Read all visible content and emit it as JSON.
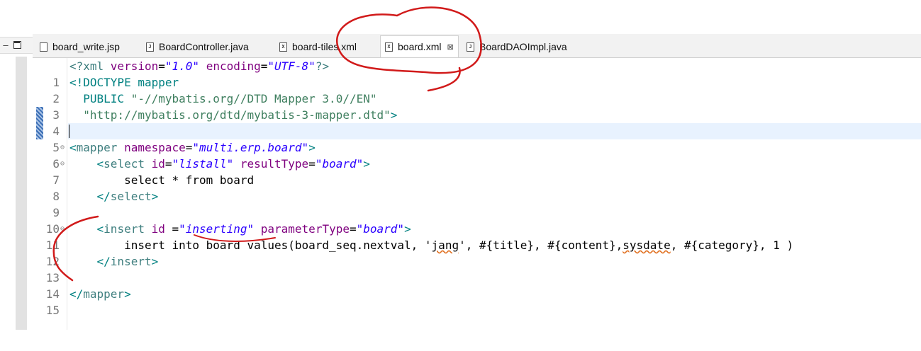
{
  "window": {
    "minimize_glyph": "–"
  },
  "tabs": [
    {
      "label": "board_write.jsp",
      "icon": "jsp-file-icon"
    },
    {
      "label": "BoardController.java",
      "icon": "java-file-icon"
    },
    {
      "label": "board-tiles.xml",
      "icon": "xml-file-icon"
    },
    {
      "label": "board.xml",
      "icon": "xml-file-icon",
      "active": true,
      "close": "⊠"
    },
    {
      "label": "BoardDAOImpl.java",
      "icon": "java-file-icon"
    }
  ],
  "editor": {
    "line_numbers": [
      "1",
      "2",
      "3",
      "4",
      "5",
      "6",
      "7",
      "8",
      "9",
      "10",
      "11",
      "12",
      "13",
      "14",
      "15"
    ],
    "lines": {
      "l1": {
        "a": "<?xml ",
        "b": "version",
        "c": "=",
        "d": "\"1.0\"",
        "e": " ",
        "f": "encoding",
        "g": "=",
        "h": "\"UTF-8\"",
        "i": "?>"
      },
      "l2": {
        "a": "<!DOCTYPE mapper"
      },
      "l3": {
        "a": "  PUBLIC ",
        "b": "\"-//mybatis.org//DTD Mapper 3.0//EN\""
      },
      "l4": {
        "a": "  ",
        "b": "\"http://mybatis.org/dtd/mybatis-3-mapper.dtd\"",
        "c": ">"
      },
      "l6": {
        "a": "<",
        "b": "mapper",
        "c": " ",
        "d": "namespace",
        "e": "=",
        "f": "\"multi.erp.board\"",
        "g": ">"
      },
      "l7": {
        "a": "    <",
        "b": "select",
        "c": " ",
        "d": "id",
        "e": "=",
        "f": "\"listall\"",
        "g": " ",
        "h": "resultType",
        "i": "=",
        "j": "\"board\"",
        "k": ">"
      },
      "l8": {
        "a": "        select * from board"
      },
      "l9": {
        "a": "    </",
        "b": "select",
        "c": ">"
      },
      "l11": {
        "a": "    <",
        "b": "insert",
        "c": " ",
        "d": "id",
        "e": " =",
        "f": "\"inserting\"",
        "g": " ",
        "h": "parameterType",
        "i": "=",
        "j": "\"board\"",
        "k": ">"
      },
      "l12": {
        "a": "        insert into board values(board_seq.nextval, '",
        "b": "jang",
        "c": "', #{title}, #{content},",
        "d": "sysdate",
        "e": ", #{category}, 1 )"
      },
      "l13": {
        "a": "    </",
        "b": "insert",
        "c": ">"
      },
      "l15": {
        "a": "</",
        "b": "mapper",
        "c": ">"
      }
    },
    "fold_glyph": "⊖",
    "current_line": "5"
  },
  "colors": {
    "tag": "#3f7f7f",
    "attribute": "#7f007f",
    "string": "#2a00ff",
    "annotation_red": "#d11a1a",
    "current_line_bg": "#e8f2fe"
  }
}
